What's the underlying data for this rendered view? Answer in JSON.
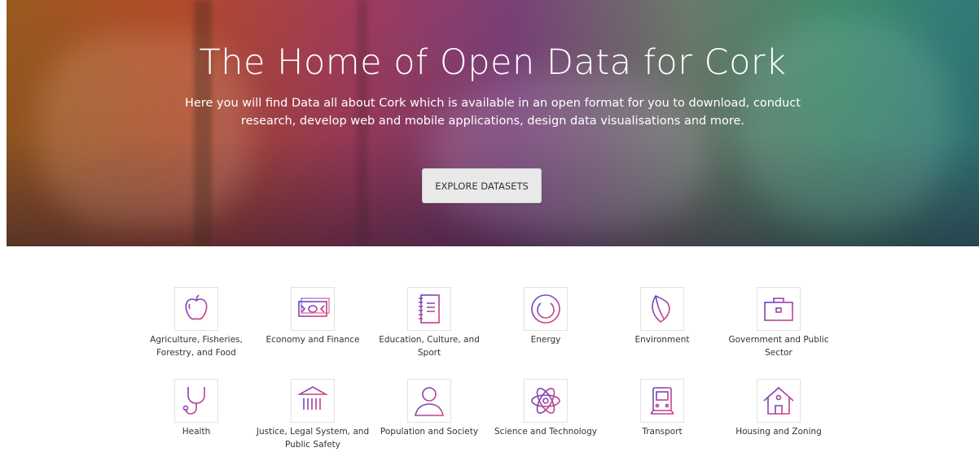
{
  "hero": {
    "title": "The Home of Open Data for Cork",
    "subtitle": "Here you will find Data all about Cork which is available in an open format for you to download, conduct research, develop web and mobile applications, design data visualisations and more.",
    "button_label": "EXPLORE DATASETS"
  },
  "categories": [
    {
      "label": "Agriculture, Fisheries, Forestry, and Food",
      "icon": "apple-icon"
    },
    {
      "label": "Economy and Finance",
      "icon": "banknote-icon"
    },
    {
      "label": "Education, Culture, and Sport",
      "icon": "notebook-icon"
    },
    {
      "label": "Energy",
      "icon": "power-icon"
    },
    {
      "label": "Environment",
      "icon": "leaf-icon"
    },
    {
      "label": "Government and Public Sector",
      "icon": "briefcase-icon"
    },
    {
      "label": "Health",
      "icon": "stethoscope-icon"
    },
    {
      "label": "Justice, Legal System, and Public Safety",
      "icon": "courthouse-icon"
    },
    {
      "label": "Population and Society",
      "icon": "person-icon"
    },
    {
      "label": "Science and Technology",
      "icon": "atom-icon"
    },
    {
      "label": "Transport",
      "icon": "train-icon"
    },
    {
      "label": "Housing and Zoning",
      "icon": "house-icon"
    }
  ],
  "colors": {
    "icon_gradient_start": "#6a3db3",
    "icon_gradient_end": "#e0407a",
    "button_bg": "#e9e9e9"
  }
}
